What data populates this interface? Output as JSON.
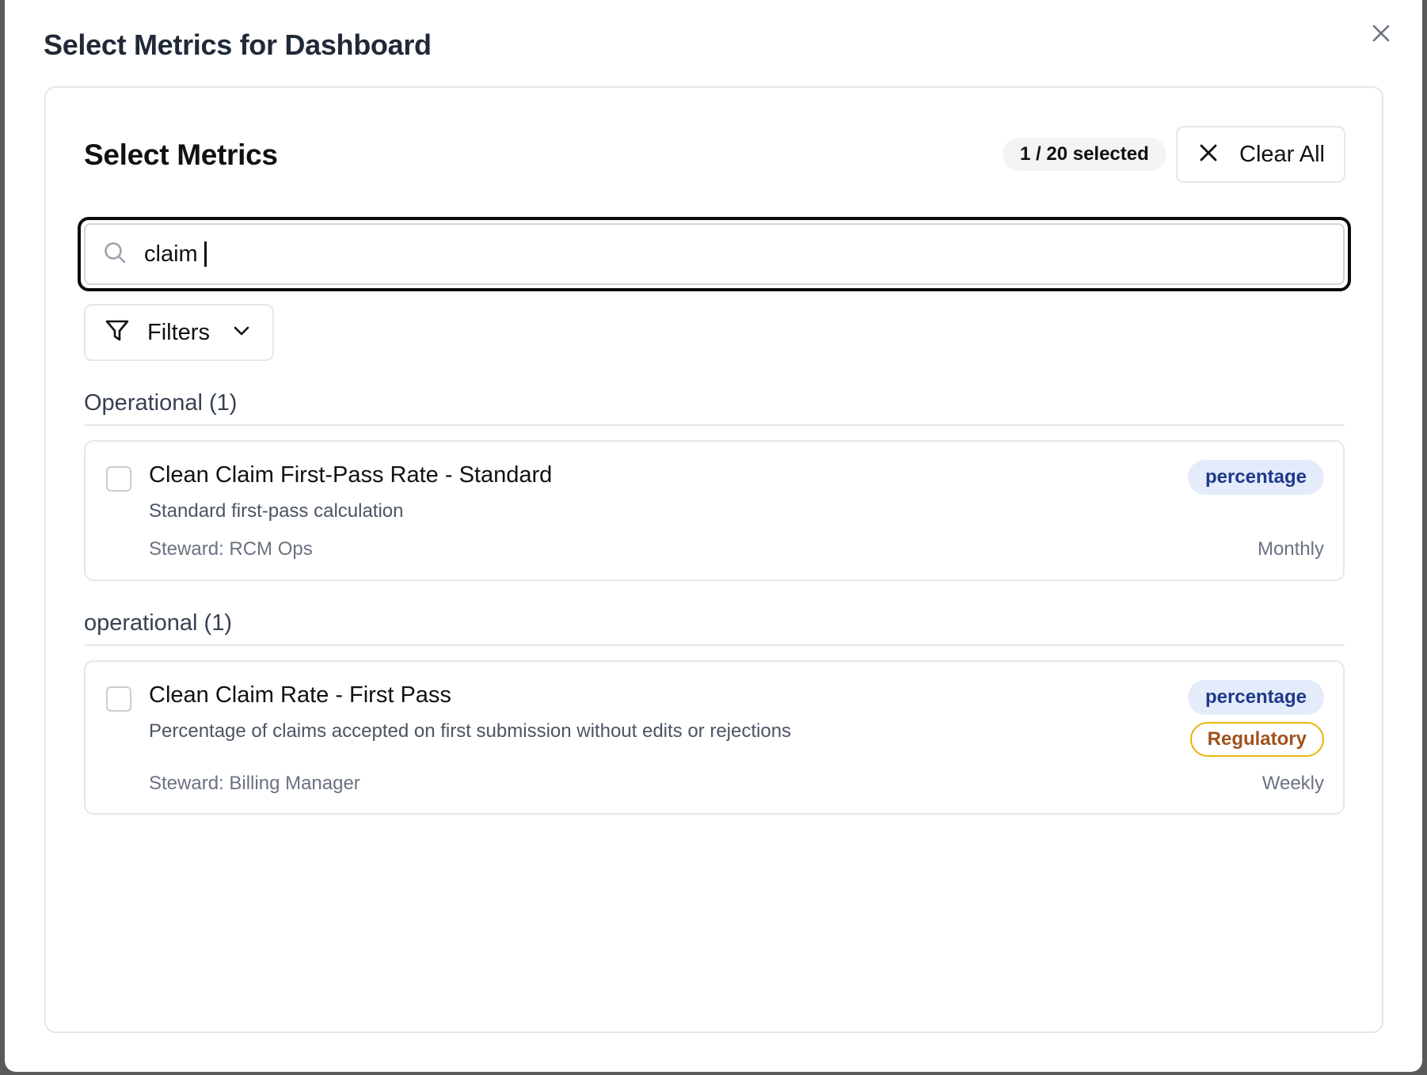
{
  "modal": {
    "title": "Select Metrics for Dashboard",
    "close_icon": "close-icon"
  },
  "panel": {
    "title": "Select Metrics",
    "selected_count": "1 / 20 selected",
    "clear_all_label": "Clear All",
    "clear_icon": "x-icon"
  },
  "search": {
    "icon": "search-icon",
    "value": "claim"
  },
  "filters": {
    "label": "Filters",
    "icon": "funnel-icon",
    "chevron": "chevron-down-icon"
  },
  "groups": [
    {
      "header": "Operational (1)",
      "metrics": [
        {
          "name": "Clean Claim First-Pass Rate - Standard",
          "description": "Standard first-pass calculation",
          "steward": "Steward: RCM Ops",
          "frequency": "Monthly",
          "type_badge": "percentage",
          "checked": false
        }
      ]
    },
    {
      "header": "operational (1)",
      "metrics": [
        {
          "name": "Clean Claim Rate - First Pass",
          "description": "Percentage of claims accepted on first submission without edits or rejections",
          "steward": "Steward: Billing Manager",
          "frequency": "Weekly",
          "type_badge": "percentage",
          "tag_badge": "Regulatory",
          "checked": false
        }
      ]
    }
  ],
  "colors": {
    "type_badge_bg": "#e4ecfb",
    "type_badge_text": "#1e3a8a",
    "regulatory_border": "#eab308",
    "regulatory_text": "#a0521c",
    "focus_ring": "#0a0a0a"
  }
}
